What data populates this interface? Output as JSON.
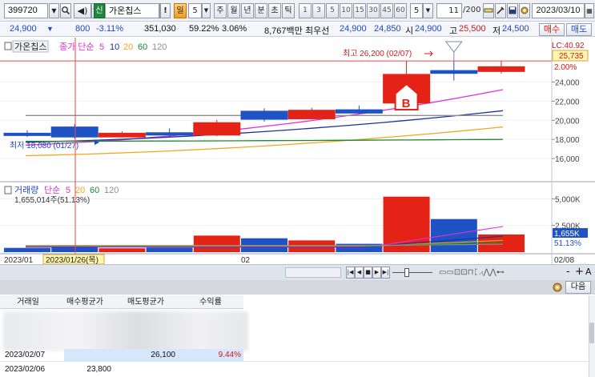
{
  "toolbar": {
    "code": "399720",
    "name_mark": "신",
    "name": "가온칩스",
    "warn": "!",
    "day": "일",
    "day_num": "5",
    "periods": [
      "주",
      "월",
      "년",
      "분",
      "초",
      "틱"
    ],
    "minutes": [
      "1",
      "3",
      "5",
      "10",
      "15",
      "30",
      "45",
      "60"
    ],
    "count_sel": "5",
    "page": "11",
    "page_total": "/200",
    "date": "2023/03/10"
  },
  "quote": {
    "price": "24,900",
    "change": "800",
    "change_pct": "-3.11%",
    "volume": "351,030",
    "vol_pct": "59.22%",
    "turn": "3.06%",
    "amount": "8,767백만",
    "best_label": "최우선",
    "best_ask": "24,900",
    "best_bid": "24,850",
    "open_label": "시",
    "open": "24,900",
    "high_label": "고",
    "high": "25,500",
    "low_label": "저",
    "low": "24,500",
    "buy": "매수",
    "sell": "매도"
  },
  "chart_data": {
    "type": "candlestick",
    "price_legend": {
      "name": "가온칩스",
      "ma_label": "종가 단순",
      "ma_periods": [
        "5",
        "10",
        "20",
        "60",
        "120"
      ]
    },
    "volume_legend": {
      "name": "거래량",
      "ma_label": "단순",
      "ma_periods": [
        "5",
        "20",
        "60",
        "120"
      ],
      "cursor_volume": "1,655,014주(51.13%)"
    },
    "price_axis": [
      "24,000",
      "22,000",
      "20,000",
      "18,000",
      "16,000"
    ],
    "price_ylim": [
      15000,
      26800
    ],
    "volume_axis": [
      "5,000K",
      "2,500K"
    ],
    "volume_ylim": [
      0,
      6000
    ],
    "lc_label": "LC:40.92",
    "current_price": "25,735",
    "current_pct": "2.00%",
    "current_volume": "1,655K",
    "current_vol_pct": "51.13%",
    "x_labels": [
      "2023/01",
      "02",
      "02/08"
    ],
    "cursor_date": "2023/01/26(목)",
    "annotations": {
      "high": "최고 26,200 (02/07)",
      "low": "최저 18,080 (01/27)",
      "marker": "B"
    },
    "candles": [
      {
        "o": 18650,
        "c": 18400,
        "h": 18950,
        "l": 18250,
        "v": 400
      },
      {
        "o": 19300,
        "c": 18250,
        "h": 19600,
        "l": 18080,
        "v": 560
      },
      {
        "o": 18250,
        "c": 18650,
        "h": 18850,
        "l": 18200,
        "v": 360
      },
      {
        "o": 18700,
        "c": 18450,
        "h": 19150,
        "l": 18300,
        "v": 430
      },
      {
        "o": 18450,
        "c": 19750,
        "h": 20050,
        "l": 18350,
        "v": 1550
      },
      {
        "o": 20950,
        "c": 20100,
        "h": 21250,
        "l": 19850,
        "v": 1300
      },
      {
        "o": 20150,
        "c": 21050,
        "h": 21300,
        "l": 20100,
        "v": 1100
      },
      {
        "o": 21100,
        "c": 20750,
        "h": 21550,
        "l": 20650,
        "v": 780
      },
      {
        "o": 21800,
        "c": 24800,
        "h": 26200,
        "l": 21800,
        "v": 5200
      },
      {
        "o": 25200,
        "c": 24900,
        "h": 26200,
        "l": 24150,
        "v": 3100
      },
      {
        "o": 25100,
        "c": 25600,
        "h": 26200,
        "l": 24900,
        "v": 1655
      }
    ],
    "ma": {
      "ma5": {
        "color": "#e02fd6",
        "start": 17400,
        "end": 23200,
        "vol_start": 480,
        "vol_end": 2400
      },
      "ma10": {
        "color": "#1f2f9e",
        "start": 17700,
        "end": 21000,
        "vol_start": 520,
        "vol_end": 1500
      },
      "ma20": {
        "color": "#f0a81c",
        "start": 16300,
        "end": 19300,
        "vol_start": 560,
        "vol_end": 1100
      },
      "ma60": {
        "color": "#1e8a2e",
        "start": 17800,
        "end": 18000,
        "vol_start": 600,
        "vol_end": 900
      },
      "ma120": {
        "color": "#8e8e8e",
        "start": 20500,
        "end": 20500,
        "vol_start": 620,
        "vol_end": 740
      }
    },
    "colors": {
      "up": "#e42316",
      "down": "#1f52c4"
    }
  },
  "nav": {
    "icons": [
      "first-icon",
      "prev-icon",
      "stop-icon",
      "next-icon",
      "last-icon"
    ],
    "right": [
      "-",
      "+",
      "A"
    ]
  },
  "next_button": "다음",
  "table": {
    "headers": [
      "거래일",
      "매수평균가",
      "매도평균가",
      "수익률"
    ],
    "rows": [
      {
        "date": "2023/02/07",
        "buy": "",
        "sell": "26,100",
        "pct": "9.44%"
      },
      {
        "date": "2023/02/06",
        "buy": "23,800",
        "sell": "",
        "pct": ""
      }
    ]
  }
}
